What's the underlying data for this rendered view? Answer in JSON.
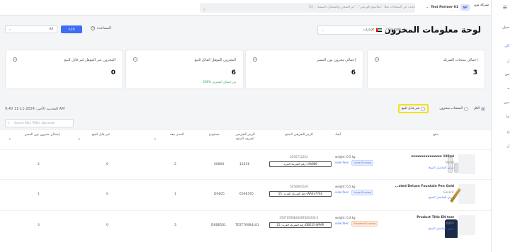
{
  "topbar": {
    "search_placeholder": "ابحث عن المنتجات مثلا: \"مكانيوم الهريس\" , \"تم الشحن والمسائل الضيقة\" , [1]",
    "partner_initials": "NP",
    "partner_name": "Test Partner 01",
    "partner_sub": "...",
    "brand": "شركة نون"
  },
  "sidebar": {
    "items": [
      "حمل",
      "الن",
      "ل",
      "س",
      "ه",
      "سن",
      "ما",
      "إذ",
      "ل"
    ]
  },
  "header": {
    "title": "لوحة معلومات المخزون",
    "country_label": "Country",
    "country_value": "الإمارات",
    "country_caret": "⌄",
    "help_label": "المساعدة",
    "export_label": "إدارة",
    "all_label": "All",
    "all_caret": "⌄"
  },
  "cards": [
    {
      "title": "إجمالي منتجات الشريك",
      "value": "3",
      "sub": ""
    },
    {
      "title": "إجمالي مخزون نون المميز",
      "value": "6",
      "sub": ""
    },
    {
      "title": "المخزون المؤهل القابل للبيع",
      "value": "6",
      "sub": "100% من إجمالي المخزون"
    },
    {
      "title": "المخزون غير المؤهل غير قابل للبيع",
      "value": "0",
      "sub": ""
    }
  ],
  "filters": {
    "updated": "التحديث الأخير: 2024-11-11 9:40 AM",
    "all": "الكل",
    "available": "المنتجات بمخزون",
    "not_sellable": "غير قابل للبيع"
  },
  "table": {
    "search_placeholder": "Search SKU, PSKU, pbarcode",
    "headers": {
      "product": "منتج",
      "dims": "أبعاد",
      "partner_id": "الرمز التعريفي المنتج",
      "partner_sub": "",
      "psku": "الرمز التعريفي لتعريف المنتج",
      "warehouse": "مستودع",
      "seller_sku": "المحجوز",
      "sellable": "المدى بيعه",
      "unsellable": "غير قابل للبيع",
      "total": "إجمالي مخزون نون المميز"
    },
    "rows": [
      {
        "name": "xxxxxxxxxxxxxxx 100ml",
        "brand": "YAHYA",
        "link": "عرض التفاصيل المنتج",
        "weight": "weight: 0.5 kg",
        "view": "view fees",
        "ship": "Large Envelop",
        "ship_type": "blue",
        "barcode": "5050712224",
        "psku": "رقم الشريك الفريد: dfs888",
        "warehouse": "12456",
        "reserved": "06800",
        "sellable": "2",
        "unsellable": "0",
        "total": "2"
      },
      {
        "name": "...sted Deluxe Fountain Pen Gold",
        "brand": "Generic",
        "link": "عرض التفاصيل المنتج",
        "weight": "weight: 0.5 kg",
        "view": "view fees",
        "ship": "Large Envelop",
        "ship_type": "blue",
        "barcode": "5050893529",
        "psku": "رقم الشريك الفريد: 55-WA2e7746",
        "warehouse": "6598565",
        "reserved": "D6805",
        "sellable": "1",
        "unsellable": "0",
        "total": "1"
      },
      {
        "name": "Product Title EN test",
        "brand": "JIWIPY",
        "link": "عرض التفاصيل المنتج",
        "weight": "weight: 0.4 kg",
        "view": "view fees",
        "ship": "Standard Envelop",
        "ship_type": "orange",
        "barcode": "2507059884d08F0D0240-1",
        "psku": "رقم الشريك الفريد: 12-DBE55-WPAR",
        "warehouse": "TEST76984L01",
        "reserved": "D6BB501",
        "sellable": "3",
        "unsellable": "0",
        "total": "3"
      }
    ]
  }
}
